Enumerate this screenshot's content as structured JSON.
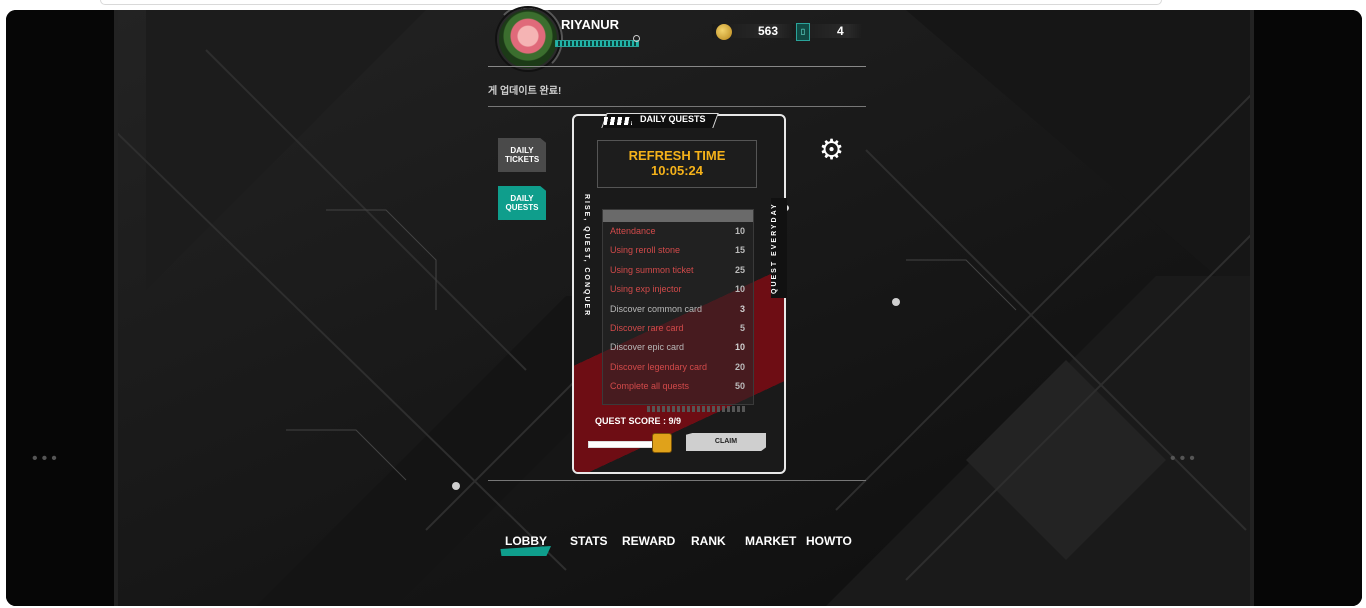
{
  "header": {
    "username": "RIYANUR",
    "coins": "563",
    "tickets": "4",
    "notice": "게 업데이트 완료!"
  },
  "side_tabs": {
    "tickets_label": "DAILY TICKETS",
    "quests_label": "DAILY QUESTS"
  },
  "card": {
    "title": "DAILY QUESTS",
    "left_vertical": "RISE, QUEST, CONQUER",
    "right_vertical": "QUEST EVERYDAY",
    "refresh_label": "REFRESH TIME",
    "refresh_time": "10:05:24",
    "quests": [
      {
        "name": "Attendance",
        "points": "10",
        "done": true
      },
      {
        "name": "Using reroll stone",
        "points": "15",
        "done": true
      },
      {
        "name": "Using summon ticket",
        "points": "25",
        "done": true
      },
      {
        "name": "Using exp injector",
        "points": "10",
        "done": true
      },
      {
        "name": "Discover common card",
        "points": "3",
        "done": false
      },
      {
        "name": "Discover rare card",
        "points": "5",
        "done": true
      },
      {
        "name": "Discover epic card",
        "points": "10",
        "done": false
      },
      {
        "name": "Discover legendary card",
        "points": "20",
        "done": true
      },
      {
        "name": "Complete all quests",
        "points": "50",
        "done": true
      }
    ],
    "score_text": "QUEST SCORE : 9/9",
    "score_fraction": 1.0,
    "claim_label": "CLAIM"
  },
  "nav": {
    "items": [
      "LOBBY",
      "STATS",
      "REWARD",
      "RANK",
      "MARKET",
      "HOWTO"
    ],
    "active": "LOBBY"
  },
  "colors": {
    "accent": "#0f9e8c",
    "refresh": "#f5b21a",
    "quest_done": "#d24a4a",
    "card_red": "#6e0d14"
  },
  "icons": {
    "settings": "gear-icon",
    "coin": "coin-icon",
    "ticket": "ticket-icon",
    "chest": "chest-icon"
  }
}
